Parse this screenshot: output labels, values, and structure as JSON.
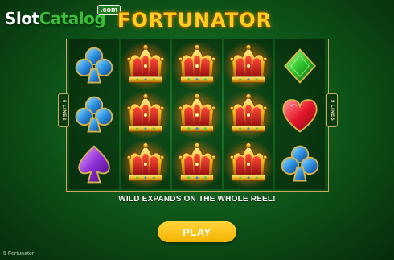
{
  "watermark": {
    "prefix": "Slot",
    "accent": "Catalog",
    "badge": ".com"
  },
  "logo": {
    "title": "FORTUNATOR"
  },
  "lines_label": "5 LINES",
  "message": "WILD EXPANDS ON THE WHOLE REEL!",
  "play_label": "PLAY",
  "footer": "5 Fortunator",
  "reels": [
    [
      "club-blue",
      "club-blue",
      "spade-purple"
    ],
    [
      "crown",
      "crown",
      "crown"
    ],
    [
      "crown",
      "crown",
      "crown"
    ],
    [
      "crown",
      "crown",
      "crown"
    ],
    [
      "diamond-green",
      "heart-red",
      "club-blue"
    ]
  ],
  "colors": {
    "background": "#0f5a1a",
    "gold": "#ffce1f",
    "frame": "#c8a860",
    "play_button": "#f5b400"
  }
}
